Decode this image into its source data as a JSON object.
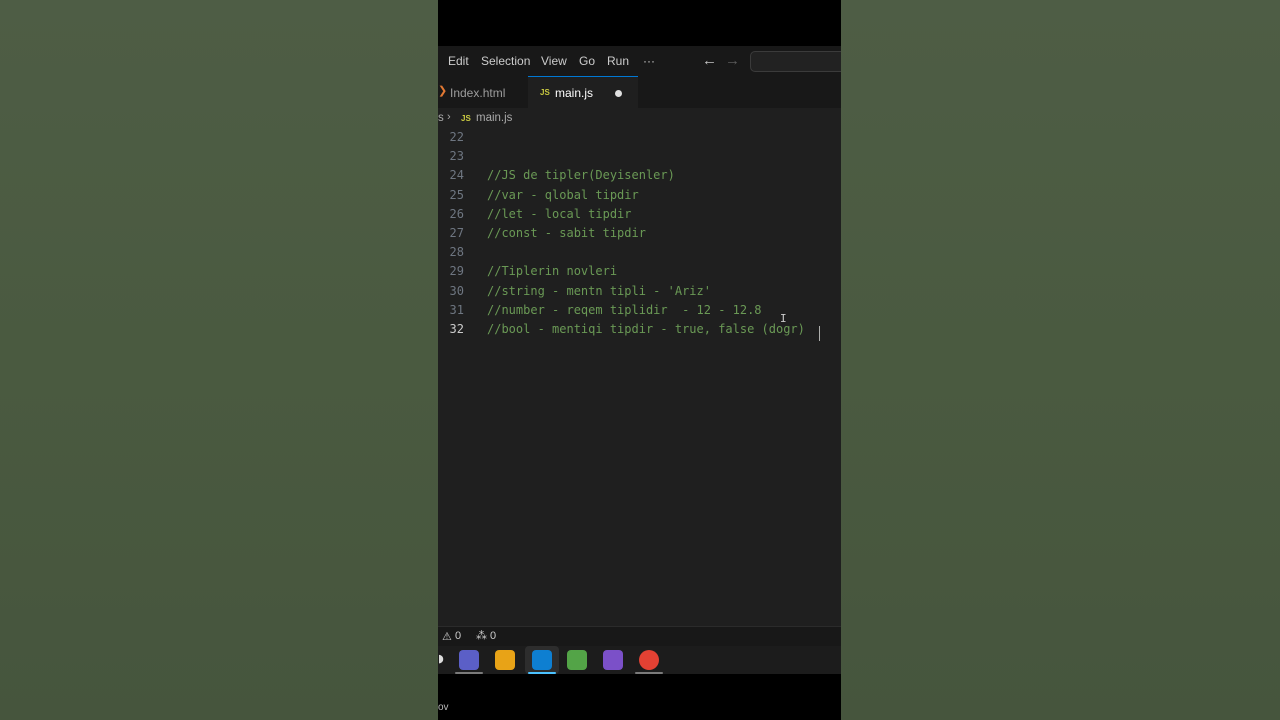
{
  "menu": {
    "items": [
      "Edit",
      "Selection",
      "View",
      "Go",
      "Run"
    ],
    "more": "···",
    "back_icon": "←",
    "forward_icon": "→"
  },
  "tabs": [
    {
      "label": "Index.html",
      "icon": "html-icon",
      "active": false
    },
    {
      "label": "main.js",
      "icon": "js-icon",
      "active": true,
      "unsaved": true
    }
  ],
  "breadcrumb": {
    "segment_a": "s",
    "segment_b": "main.js",
    "js_badge": "JS"
  },
  "editor": {
    "active_line": 32,
    "lines": [
      {
        "num": "22",
        "text": ""
      },
      {
        "num": "23",
        "text": ""
      },
      {
        "num": "24",
        "text": "//JS de tipler(Deyisenler)"
      },
      {
        "num": "25",
        "text": "//var - qlobal tipdir"
      },
      {
        "num": "26",
        "text": "//let - local tipdir"
      },
      {
        "num": "27",
        "text": "//const - sabit tipdir"
      },
      {
        "num": "28",
        "text": ""
      },
      {
        "num": "29",
        "text": "//Tiplerin novleri"
      },
      {
        "num": "30",
        "text": "//string - mentn tipli - 'Ariz'"
      },
      {
        "num": "31",
        "text": "//number - reqem tiplidir  - 12 - 12.8"
      },
      {
        "num": "32",
        "text": "//bool - mentiqi tipdir - true, false (dogr)"
      }
    ]
  },
  "status": {
    "warnings": "0",
    "ports": "0",
    "warn_icon": "⚠",
    "ports_icon": "⁂"
  },
  "taskbar": {
    "apps": [
      {
        "name": "teams",
        "color": "#5b5fc7"
      },
      {
        "name": "figma",
        "color": "#e8a317"
      },
      {
        "name": "vscode",
        "color": "#0e7fd1"
      },
      {
        "name": "notepad",
        "color": "#53a447"
      },
      {
        "name": "visual-studio",
        "color": "#7b50c8"
      },
      {
        "name": "chrome",
        "color": "#e34133"
      }
    ]
  },
  "bottom_text": "ov"
}
